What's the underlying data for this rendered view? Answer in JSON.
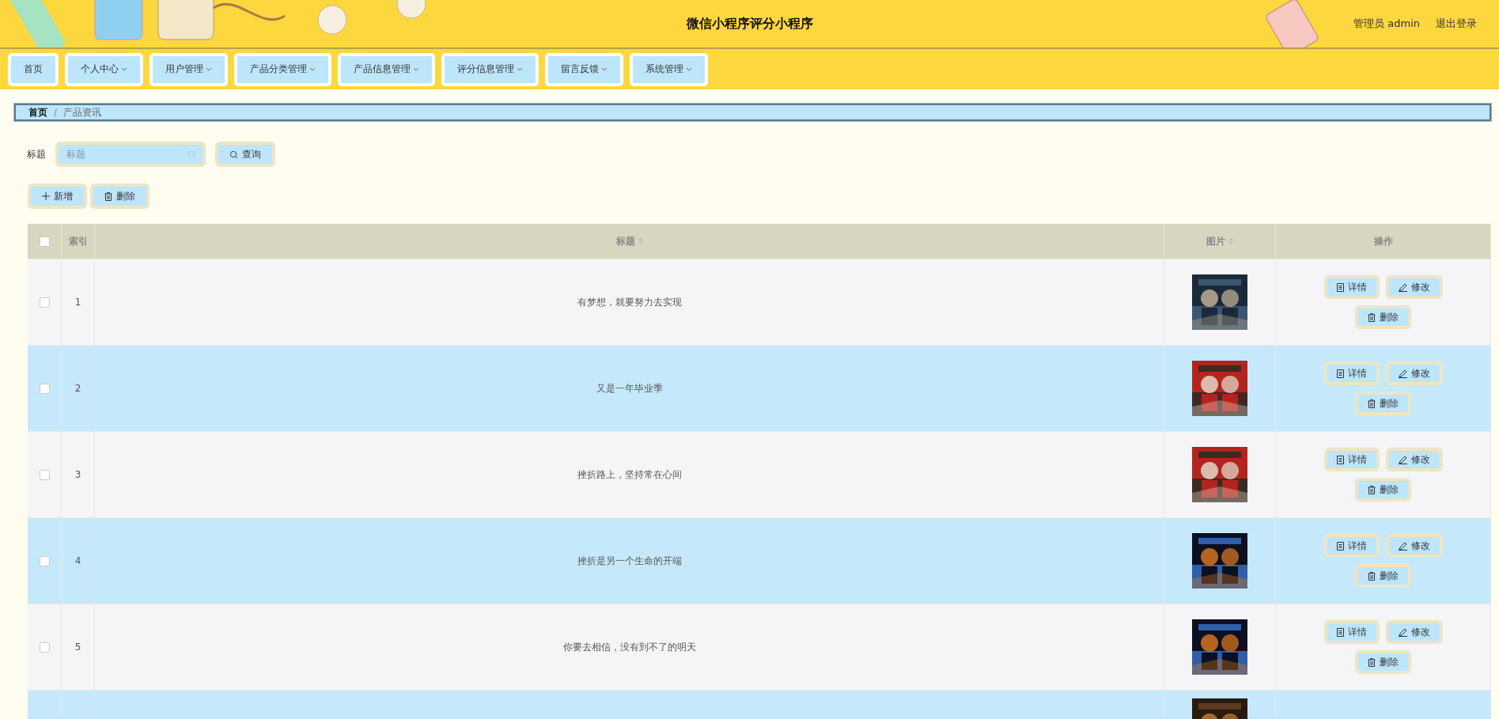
{
  "header": {
    "title": "微信小程序评分小程序",
    "user": "管理员 admin",
    "logout": "退出登录"
  },
  "nav": [
    {
      "label": "首页",
      "has_menu": false
    },
    {
      "label": "个人中心",
      "has_menu": true
    },
    {
      "label": "用户管理",
      "has_menu": true
    },
    {
      "label": "产品分类管理",
      "has_menu": true
    },
    {
      "label": "产品信息管理",
      "has_menu": true
    },
    {
      "label": "评分信息管理",
      "has_menu": true
    },
    {
      "label": "留言反馈",
      "has_menu": true
    },
    {
      "label": "系统管理",
      "has_menu": true
    }
  ],
  "breadcrumb": {
    "items": [
      "首页",
      "产品资讯"
    ],
    "separator": "/"
  },
  "search": {
    "label": "标题",
    "placeholder": "标题",
    "button": "查询"
  },
  "toolbar": {
    "add": "新增",
    "delete": "删除"
  },
  "table": {
    "select_all": {
      "checked": false
    },
    "columns": [
      {
        "label": "索引",
        "sortable": false
      },
      {
        "label": "标题",
        "sortable": true
      },
      {
        "label": "图片",
        "sortable": true
      },
      {
        "label": "操作",
        "sortable": false
      }
    ],
    "rows": [
      {
        "checked": false,
        "index": "1",
        "title": "有梦想，就要努力去实现",
        "image": {
          "kind": "picture"
        },
        "actions": {
          "detail": "详情",
          "edit": "修改",
          "delete": "删除"
        }
      },
      {
        "checked": false,
        "index": "2",
        "title": "又是一年毕业季",
        "image": {
          "kind": "picture"
        },
        "actions": {
          "detail": "详情",
          "edit": "修改",
          "delete": "删除"
        }
      },
      {
        "checked": false,
        "index": "3",
        "title": "挫折路上，坚持常在心间",
        "image": {
          "kind": "picture"
        },
        "actions": {
          "detail": "详情",
          "edit": "修改",
          "delete": "删除"
        }
      },
      {
        "checked": false,
        "index": "4",
        "title": "挫折是另一个生命的开端",
        "image": {
          "kind": "picture"
        },
        "actions": {
          "detail": "详情",
          "edit": "修改",
          "delete": "删除"
        }
      },
      {
        "checked": false,
        "index": "5",
        "title": "你要去相信，没有到不了的明天",
        "image": {
          "kind": "picture"
        },
        "actions": {
          "detail": "详情",
          "edit": "修改",
          "delete": "删除"
        }
      },
      {
        "image": {
          "kind": "picture"
        }
      }
    ]
  }
}
